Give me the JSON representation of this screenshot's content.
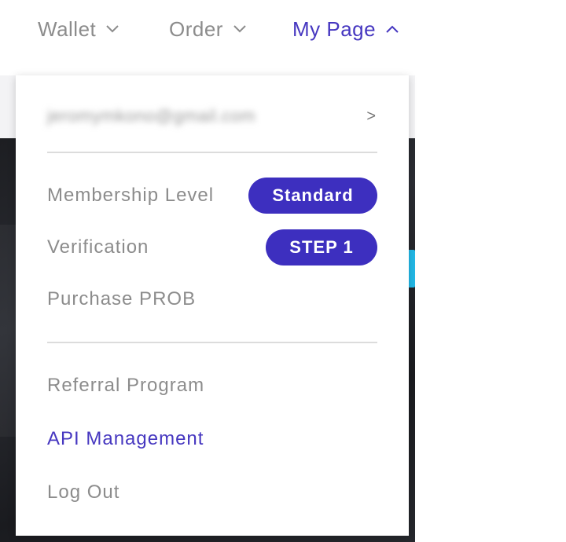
{
  "nav": {
    "items": [
      {
        "label": "Wallet",
        "icon": "chevron-down-icon",
        "active": false
      },
      {
        "label": "Order",
        "icon": "chevron-down-icon",
        "active": false
      },
      {
        "label": "My Page",
        "icon": "chevron-up-icon",
        "active": true
      }
    ]
  },
  "dropdown": {
    "email": "jeromymkono@gmail.com",
    "email_arrow": ">",
    "membership": {
      "label": "Membership Level",
      "badge": "Standard"
    },
    "verification": {
      "label": "Verification",
      "badge": "STEP 1"
    },
    "purchase": {
      "label": "Purchase PROB"
    },
    "referral": {
      "label": "Referral Program"
    },
    "api": {
      "label": "API Management"
    },
    "logout": {
      "label": "Log Out"
    }
  },
  "colors": {
    "accent": "#4637c0",
    "badge": "#3d2fbf",
    "muted_text": "#8c8c8c"
  }
}
